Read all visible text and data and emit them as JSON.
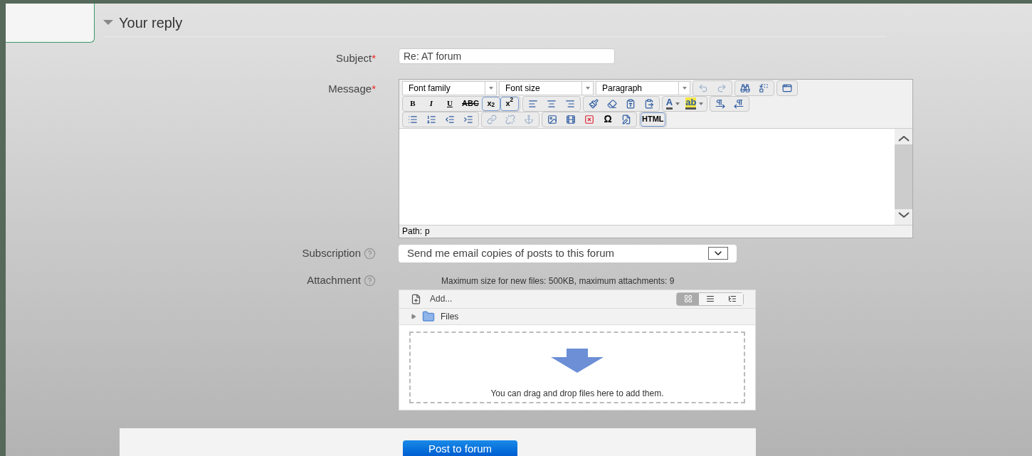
{
  "section": {
    "title": "Your reply",
    "expanded": true
  },
  "subject": {
    "label": "Subject",
    "required_mark": "*",
    "value": "Re: AT forum"
  },
  "message": {
    "label": "Message",
    "required_mark": "*",
    "toolbar": [
      {
        "selects": [
          {
            "label": "Font family"
          },
          {
            "label": "Font size"
          },
          {
            "label": "Paragraph"
          }
        ],
        "groups": [
          [
            {
              "kind": "icon",
              "disabled": true
            },
            {
              "kind": "icon",
              "disabled": true
            }
          ],
          [
            {
              "kind": "icon",
              "disabled": false
            },
            {
              "kind": "icon",
              "disabled": false
            }
          ],
          [
            {
              "kind": "icon",
              "disabled": false
            }
          ]
        ]
      },
      {
        "groups": [
          [
            {
              "kind": "glyph",
              "label": "B",
              "disabled": false
            },
            {
              "kind": "glyph",
              "label": "I",
              "disabled": false
            },
            {
              "kind": "glyph",
              "label": "U",
              "disabled": false
            },
            {
              "kind": "glyph",
              "label": "ABC",
              "disabled": false
            },
            {
              "kind": "glyph",
              "label": "x$_{2}$",
              "disabled": false
            },
            {
              "kind": "glyph",
              "label": "x$^{2}$",
              "disabled": false
            }
          ],
          [
            {
              "kind": "icon",
              "disabled": false
            },
            {
              "kind": "icon",
              "disabled": false
            },
            {
              "kind": "icon",
              "disabled": false
            }
          ],
          [
            {
              "kind": "icon",
              "disabled": false
            },
            {
              "kind": "icon",
              "disabled": false
            },
            {
              "kind": "icon",
              "disabled": false
            },
            {
              "kind": "icon",
              "disabled": false
            }
          ],
          [
            {
              "kind": "split",
              "label": "A",
              "disabled": false
            },
            {
              "kind": "split",
              "label": "ab",
              "disabled": false
            }
          ],
          [
            {
              "kind": "icon",
              "disabled": false
            },
            {
              "kind": "icon",
              "disabled": false
            }
          ]
        ]
      },
      {
        "groups": [
          [
            {
              "kind": "icon",
              "disabled": false
            },
            {
              "kind": "icon",
              "disabled": false
            },
            {
              "kind": "icon",
              "disabled": false
            },
            {
              "kind": "icon",
              "disabled": false
            }
          ],
          [
            {
              "kind": "icon",
              "disabled": true
            },
            {
              "kind": "icon",
              "disabled": true
            },
            {
              "kind": "icon",
              "disabled": true
            }
          ],
          [
            {
              "kind": "icon",
              "disabled": false
            },
            {
              "kind": "icon",
              "disabled": false
            },
            {
              "kind": "icon",
              "disabled": false
            },
            {
              "kind": "glyph",
              "label": "Ω",
              "disabled": false
            },
            {
              "kind": "icon",
              "disabled": false
            }
          ],
          [
            {
              "kind": "glyph",
              "label": "HTML",
              "disabled": false
            }
          ]
        ]
      }
    ],
    "path_label": "Path:",
    "path": "p"
  },
  "subscription": {
    "label": "Subscription",
    "value": "Send me email copies of posts to this forum"
  },
  "attachment": {
    "label": "Attachment",
    "notice": "Maximum size for new files: 500KB, maximum attachments: 9",
    "add": "Add...",
    "views": [
      {
        "selected": true
      },
      {
        "selected": false
      },
      {
        "selected": false
      }
    ],
    "folder": "Files",
    "drop_hint": "You can drag and drop files here to add them."
  },
  "submit": "Post to forum"
}
